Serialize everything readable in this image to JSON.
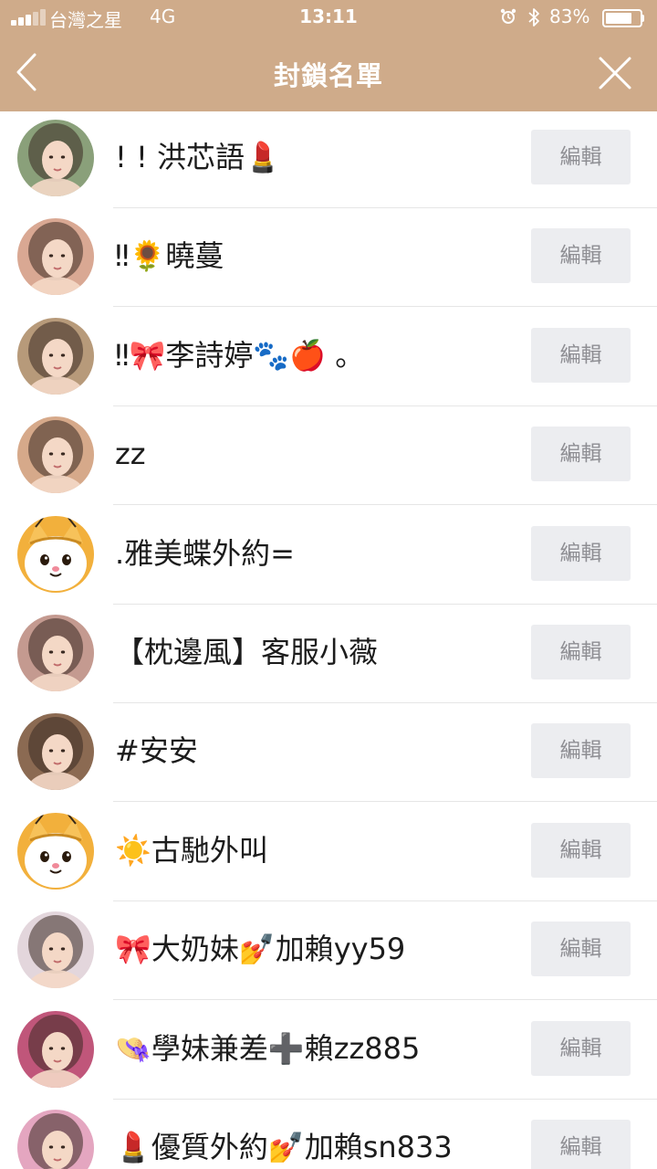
{
  "status_bar": {
    "carrier": "台灣之星",
    "network": "4G",
    "time": "13:11",
    "battery_percent": "83%",
    "battery_level": 0.83,
    "icons": [
      "signal-icon",
      "alarm-icon",
      "bluetooth-icon",
      "battery-icon"
    ]
  },
  "nav": {
    "title": "封鎖名單",
    "back_icon": "chevron-left-icon",
    "close_icon": "close-icon",
    "bar_color": "#cfab8a"
  },
  "blocked_list": {
    "edit_label": "編輯",
    "items": [
      {
        "name": "! ! 洪芯語💄",
        "avatar": "photo-avatar",
        "avatar_color": "#8aa07a"
      },
      {
        "name": "‼🌻曉蔓",
        "avatar": "photo-avatar",
        "avatar_color": "#d9a893"
      },
      {
        "name": "‼🎀李詩婷🐾🍎 。",
        "avatar": "photo-avatar",
        "avatar_color": "#b79a7a"
      },
      {
        "name": "zz",
        "avatar": "photo-avatar",
        "avatar_color": "#d6a98a"
      },
      {
        "name": ".雅美蝶外約=",
        "avatar": "cartoon-cat-avatar",
        "avatar_color": "#f2b03c"
      },
      {
        "name": "【枕邊風】客服小薇",
        "avatar": "photo-avatar",
        "avatar_color": "#c49a90"
      },
      {
        "name": "#安安",
        "avatar": "photo-avatar",
        "avatar_color": "#8b6a52"
      },
      {
        "name": "☀️古馳外叫",
        "avatar": "cartoon-cat-avatar",
        "avatar_color": "#f2b03c"
      },
      {
        "name": "🎀大奶妹💅加賴yy59",
        "avatar": "photo-avatar",
        "avatar_color": "#e3d6dc"
      },
      {
        "name": "👒學妹兼差➕賴zz885",
        "avatar": "photo-avatar",
        "avatar_color": "#c0567a"
      },
      {
        "name": "💄優質外約💅加賴sn833",
        "avatar": "photo-avatar",
        "avatar_color": "#e4a6c0"
      }
    ]
  }
}
